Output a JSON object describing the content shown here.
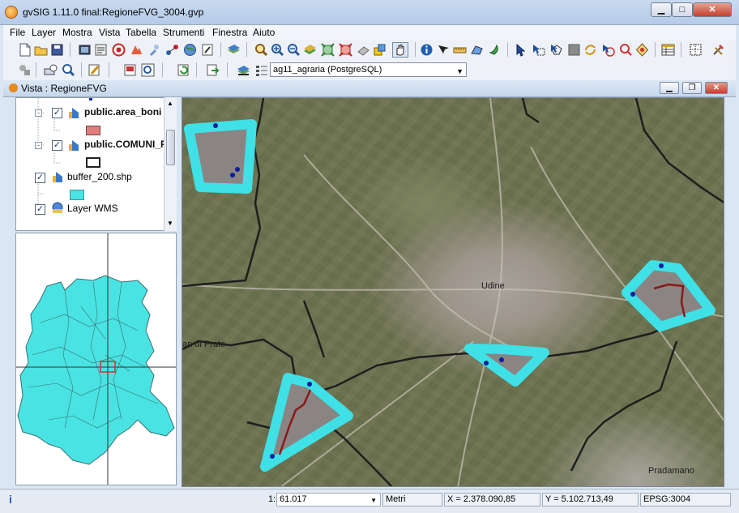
{
  "window": {
    "title": "gvSIG 1.11.0 final:RegioneFVG_3004.gvp"
  },
  "menu": [
    "File",
    "Layer",
    "Mostra",
    "Vista",
    "Tabella",
    "Strumenti",
    "Finestra",
    "Aiuto"
  ],
  "toolbar": {
    "layer_selector_value": "ag11_agraria (PostgreSQL)"
  },
  "view": {
    "title": "Vista : RegioneFVG"
  },
  "toc": {
    "layers": [
      {
        "label": "public.area_boni",
        "checked": true,
        "symbol_color": "#e07d7d"
      },
      {
        "label": "public.COMUNI_F",
        "checked": true,
        "symbol_color": "#ffffff"
      },
      {
        "label": "buffer_200.shp",
        "checked": true,
        "symbol_color": "#49e3e3"
      },
      {
        "label": "Layer WMS",
        "checked": true
      }
    ]
  },
  "map": {
    "labels": [
      "Udine",
      "an di Prato",
      "Pradamano"
    ]
  },
  "statusbar": {
    "scale_prefix": "1:",
    "scale_value": "61.017",
    "units": "Metri",
    "x": "X = 2.378.090,85",
    "y": "Y = 5.102.713,49",
    "crs": "EPSG:3004"
  },
  "colors": {
    "buffer": "#3fe0e6",
    "area": "#8a8483",
    "boundary": "#1e1e1e",
    "region_fill": "#49e3e3"
  }
}
